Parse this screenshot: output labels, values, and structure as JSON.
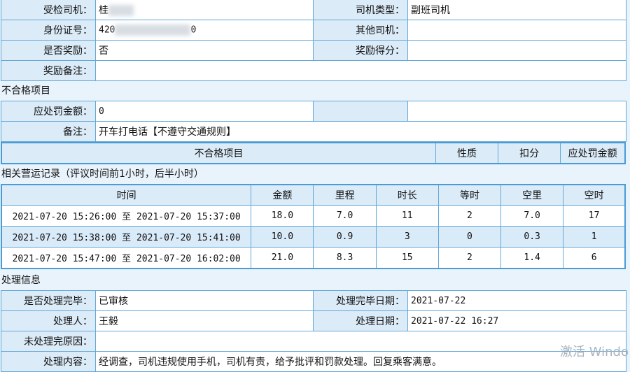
{
  "driver_info": {
    "inspected_driver_label": "受检司机：",
    "inspected_driver_value": "桂",
    "driver_type_label": "司机类型：",
    "driver_type_value": "副班司机",
    "id_number_label": "身份证号：",
    "id_number_prefix": "420",
    "id_number_suffix": "0",
    "other_driver_label": "其他司机：",
    "other_driver_value": "",
    "reward_label": "是否奖励：",
    "reward_value": "否",
    "reward_score_label": "奖励得分：",
    "reward_score_value": "",
    "reward_note_label": "奖励备注：",
    "reward_note_value": ""
  },
  "nonconformity": {
    "section_title": "不合格项目",
    "fine_label": "应处罚金额：",
    "fine_value": "0",
    "note_label": "备注：",
    "note_value": "开车打电话【不遵守交通规则】",
    "columns": [
      "不合格项目",
      "性质",
      "扣分",
      "应处罚金额"
    ]
  },
  "operation_records": {
    "section_title": "相关营运记录（评议时间前1小时，后半小时）",
    "columns": [
      "时间",
      "金额",
      "里程",
      "时长",
      "等时",
      "空里",
      "空时"
    ],
    "rows": [
      [
        "2021-07-20 15:26:00 至 2021-07-20 15:37:00",
        "18.0",
        "7.0",
        "11",
        "2",
        "7.0",
        "17"
      ],
      [
        "2021-07-20 15:38:00 至 2021-07-20 15:41:00",
        "10.0",
        "0.9",
        "3",
        "0",
        "0.3",
        "1"
      ],
      [
        "2021-07-20 15:47:00 至 2021-07-20 16:02:00",
        "21.0",
        "8.3",
        "15",
        "2",
        "1.4",
        "6"
      ]
    ]
  },
  "processing": {
    "section_title": "处理信息",
    "completed_label": "是否处理完毕：",
    "completed_value": "已审核",
    "completed_date_label": "处理完毕日期：",
    "completed_date_value": "2021-07-22",
    "handler_label": "处理人：",
    "handler_value": "王毅",
    "process_date_label": "处理日期：",
    "process_date_value": "2021-07-22 16:27",
    "incomplete_reason_label": "未处理完原因：",
    "incomplete_reason_value": "",
    "content_label": "处理内容：",
    "content_value": "经调查，司机违规使用手机，司机有责，给予批评和罚款处理。回复乘客满意。"
  },
  "watermark": "激活 Windo"
}
